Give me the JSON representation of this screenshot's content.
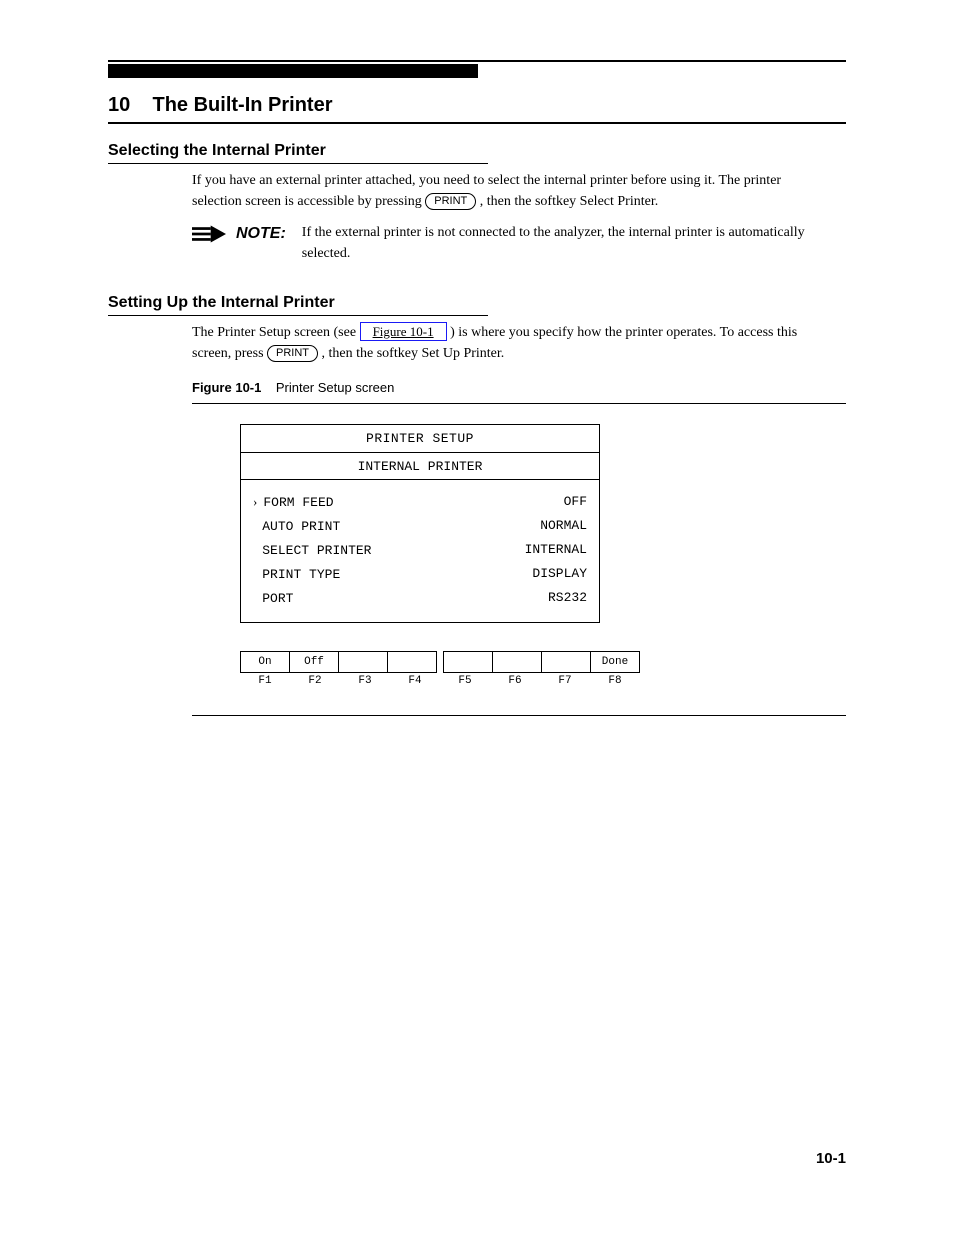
{
  "chapter": {
    "number": "10",
    "title": "The Built-In Printer"
  },
  "sections": {
    "selecting": {
      "title": "Selecting the Internal Printer",
      "p1_pre": "If you have an external printer attached, you need to select the internal printer before using it. The printer selection screen is accessible by pressing ",
      "btn_print": "PRINT",
      "p1_post": ", then the softkey Select Printer.",
      "note_label": "NOTE:",
      "note_text": "If the external printer is not connected to the analyzer, the internal printer is automatically selected."
    },
    "setup": {
      "title": "Setting Up the Internal Printer",
      "p1_a": "The Printer Setup screen (see ",
      "link_text": "Figure 10-1",
      "p1_b": ") is where you specify how the printer operates. To access this screen, press ",
      "btn_print": "PRINT",
      "p1_c": ", then the softkey Set Up Printer."
    }
  },
  "figure": {
    "number": "Figure 10-1",
    "caption": "Printer Setup screen",
    "panel": {
      "title": "PRINTER SETUP",
      "subtitle": "INTERNAL PRINTER",
      "rows": [
        {
          "arrow": "›",
          "label": "FORM FEED",
          "value": "OFF"
        },
        {
          "arrow": "",
          "label": "AUTO PRINT",
          "value": "NORMAL"
        },
        {
          "arrow": "",
          "label": "SELECT PRINTER",
          "value": "INTERNAL"
        },
        {
          "arrow": "",
          "label": "PRINT TYPE",
          "value": "DISPLAY"
        },
        {
          "arrow": "",
          "label": "PORT",
          "value": "RS232"
        }
      ]
    },
    "softkeys": [
      "On",
      "Off",
      "",
      "",
      "",
      "",
      "",
      "Done"
    ],
    "softkey_nums": [
      "F1",
      "F2",
      "F3",
      "F4",
      "F5",
      "F6",
      "F7",
      "F8"
    ]
  },
  "page_number": "10-1"
}
